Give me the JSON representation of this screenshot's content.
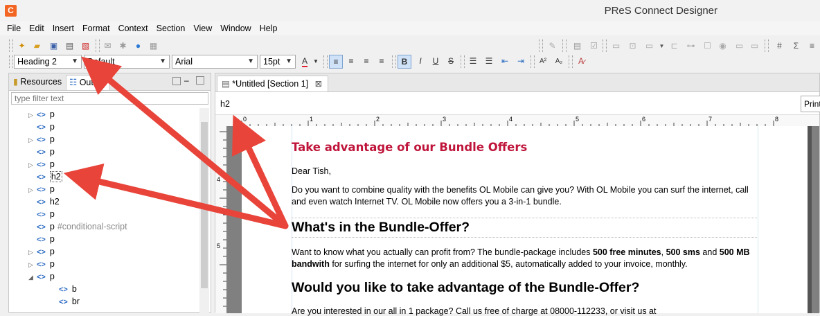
{
  "window": {
    "title": "PReS Connect Designer",
    "app_icon": "C"
  },
  "menu": [
    "File",
    "Edit",
    "Insert",
    "Format",
    "Context",
    "Section",
    "View",
    "Window",
    "Help"
  ],
  "format_toolbar": {
    "style": "Heading 2",
    "class": "Default",
    "font": "Arial",
    "size": "15pt"
  },
  "left_panel": {
    "tabs": [
      "Resources",
      "Outline"
    ],
    "filter_placeholder": "type filter text",
    "tree": [
      {
        "label": "p",
        "expander": "▷",
        "level": 1
      },
      {
        "label": "p",
        "expander": "",
        "level": 1
      },
      {
        "label": "p",
        "expander": "▷",
        "level": 1
      },
      {
        "label": "p",
        "expander": "",
        "level": 1
      },
      {
        "label": "p",
        "expander": "▷",
        "level": 1
      },
      {
        "label": "h2",
        "expander": "",
        "level": 1,
        "selected": true
      },
      {
        "label": "p",
        "expander": "▷",
        "level": 1
      },
      {
        "label": "h2",
        "expander": "",
        "level": 1
      },
      {
        "label": "p",
        "expander": "",
        "level": 1
      },
      {
        "label": "p",
        "expander": "",
        "level": 1,
        "note": "#conditional-script"
      },
      {
        "label": "p",
        "expander": "",
        "level": 1
      },
      {
        "label": "p",
        "expander": "▷",
        "level": 1
      },
      {
        "label": "p",
        "expander": "▷",
        "level": 1
      },
      {
        "label": "p",
        "expander": "◢",
        "level": 1
      },
      {
        "label": "b",
        "expander": "",
        "level": 2
      },
      {
        "label": "br",
        "expander": "",
        "level": 2
      }
    ]
  },
  "editor": {
    "tab_label": "*Untitled [Section 1]",
    "breadcrumb": "h2",
    "print_button": "Print",
    "ruler_ticks": [
      "0",
      "1",
      "2",
      "3",
      "4",
      "5",
      "6",
      "7",
      "8"
    ],
    "vruler_ticks": [
      "4",
      "5"
    ]
  },
  "document": {
    "heading_offer": "Take advantage of our Bundle Offers",
    "salutation": "Dear Tish,",
    "para1": "Do you want to combine quality with the benefits OL Mobile can give you? With OL Mobile you can surf the internet, call and even watch Internet TV. OL Mobile now offers you a 3-in-1 bundle.",
    "h2_whats_in": "What's in the Bundle-Offer?",
    "para2_start": "Want to know what you actually can profit from? The bundle-package includes ",
    "para2_b1": "500 free minutes",
    "para2_sep1": ", ",
    "para2_b2": "500 sms",
    "para2_and": " and ",
    "para2_b3": "500 MB bandwith",
    "para2_end": " for surfing the internet for only an additional $5, automatically added to your invoice, monthly.",
    "h2_would_you": "Would you like to take advantage of the Bundle-Offer?",
    "para3": "Are you interested in our all in 1 package? Call us free of charge at 08000-112233, or visit us at"
  },
  "colors": {
    "heading_red": "#c0153b",
    "arrow_red": "#e8443a",
    "tree_tag_blue": "#2a6ac2"
  }
}
